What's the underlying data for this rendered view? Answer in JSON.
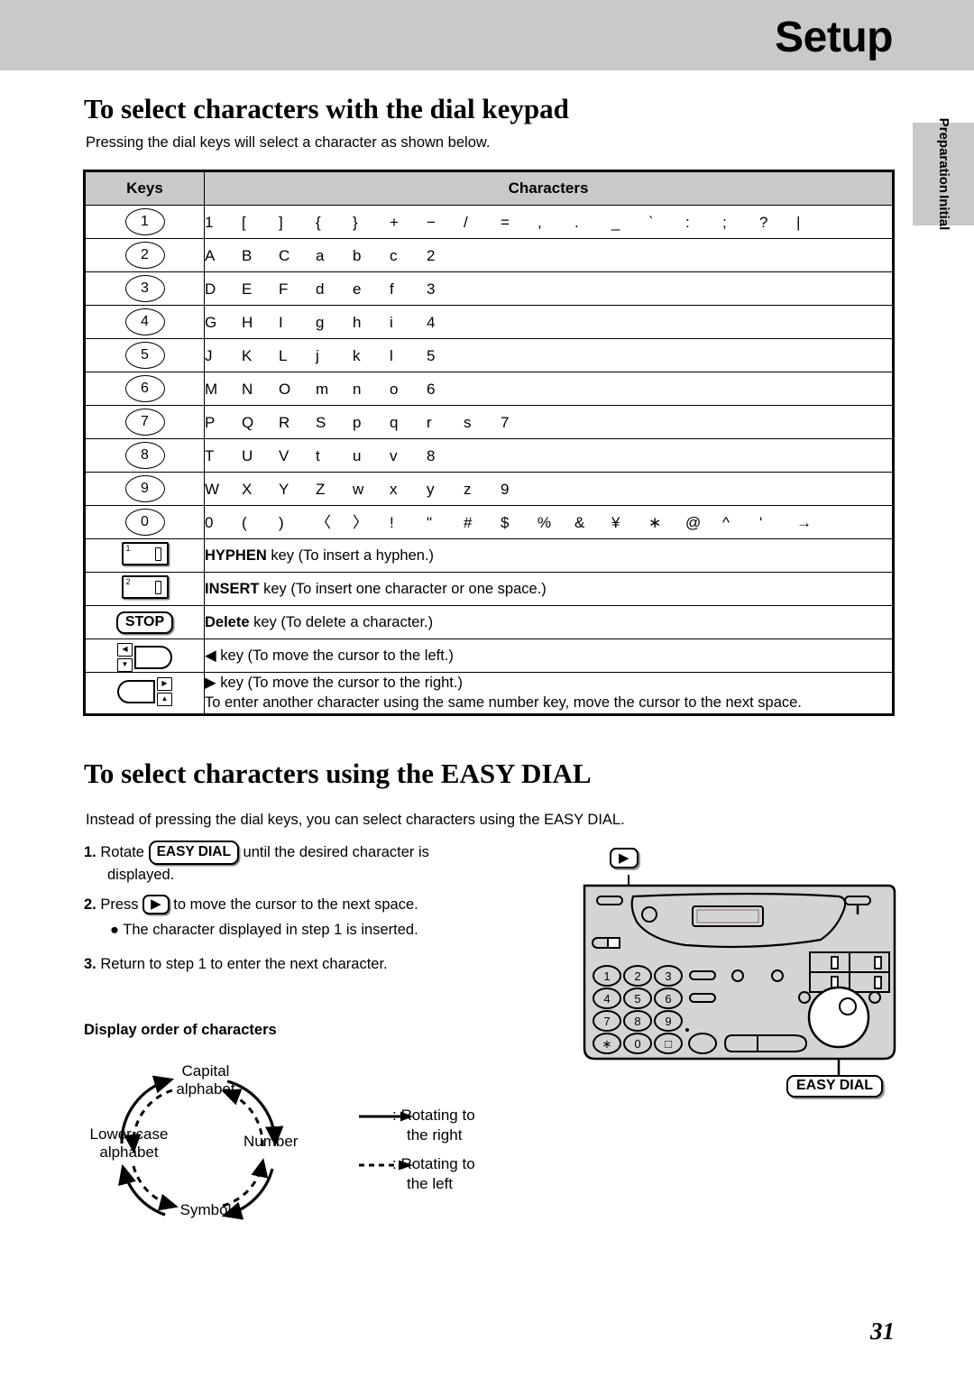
{
  "header": {
    "title": "Setup"
  },
  "side_tab": {
    "line1": "Initial",
    "line2": "Preparation"
  },
  "section1": {
    "heading": "To select characters with the dial keypad",
    "intro": "Pressing the dial keys will select a character as shown below.",
    "table": {
      "columns": [
        "Keys",
        "Characters"
      ],
      "rows": [
        {
          "key_type": "digit",
          "key": "1",
          "chars": [
            "1",
            "[",
            "]",
            "{",
            "}",
            "+",
            "−",
            "/",
            "=",
            ",",
            ".",
            "_",
            "`",
            ":",
            ";",
            "?",
            "|"
          ]
        },
        {
          "key_type": "digit",
          "key": "2",
          "chars": [
            "A",
            "B",
            "C",
            "a",
            "b",
            "c",
            "2"
          ]
        },
        {
          "key_type": "digit",
          "key": "3",
          "chars": [
            "D",
            "E",
            "F",
            "d",
            "e",
            "f",
            "3"
          ]
        },
        {
          "key_type": "digit",
          "key": "4",
          "chars": [
            "G",
            "H",
            "I",
            "g",
            "h",
            "i",
            "4"
          ]
        },
        {
          "key_type": "digit",
          "key": "5",
          "chars": [
            "J",
            "K",
            "L",
            "j",
            "k",
            "l",
            "5"
          ]
        },
        {
          "key_type": "digit",
          "key": "6",
          "chars": [
            "M",
            "N",
            "O",
            "m",
            "n",
            "o",
            "6"
          ]
        },
        {
          "key_type": "digit",
          "key": "7",
          "chars": [
            "P",
            "Q",
            "R",
            "S",
            "p",
            "q",
            "r",
            "s",
            "7"
          ]
        },
        {
          "key_type": "digit",
          "key": "8",
          "chars": [
            "T",
            "U",
            "V",
            "t",
            "u",
            "v",
            "8"
          ]
        },
        {
          "key_type": "digit",
          "key": "9",
          "chars": [
            "W",
            "X",
            "Y",
            "Z",
            "w",
            "x",
            "y",
            "z",
            "9"
          ]
        },
        {
          "key_type": "digit",
          "key": "0",
          "chars": [
            "0",
            "(",
            ")",
            "〈",
            "〉",
            "!",
            "\"",
            "#",
            "$",
            "%",
            "&",
            "¥",
            "∗",
            "@",
            "^",
            "'",
            "→"
          ]
        }
      ],
      "special_rows": [
        {
          "key_type": "flat-key",
          "sup": "1",
          "label_bold": "HYPHEN",
          "label_rest": " key (To insert a hyphen.)"
        },
        {
          "key_type": "flat-key",
          "sup": "2",
          "label_bold": "INSERT",
          "label_rest": " key (To insert one character or one space.)"
        },
        {
          "key_type": "stop-key",
          "key_label": "STOP",
          "label_bold": "Delete",
          "label_rest": " key (To delete a character.)"
        },
        {
          "key_type": "nav-left",
          "badge1": "◀",
          "badge2": "▼",
          "label_bold": "",
          "label_rest": "◀ key (To move the cursor to the left.)"
        },
        {
          "key_type": "nav-right",
          "badge1": "▶",
          "badge2": "▲",
          "label_bold": "",
          "label_rest": "▶ key (To move the cursor to the right.)",
          "label_line2": "To enter another character using the same number key, move the cursor to the next space."
        }
      ]
    }
  },
  "section2": {
    "heading": "To select characters using the EASY DIAL",
    "intro": "Instead of pressing the dial keys, you can select characters using the EASY DIAL.",
    "steps": [
      {
        "num": "1.",
        "pre": "Rotate ",
        "pill": "EASY DIAL",
        "post": " until the desired character is",
        "line2": "displayed."
      },
      {
        "num": "2.",
        "pre": "Press ",
        "pill_icon": "▶",
        "post": " to move the cursor to the next space."
      },
      {
        "bullet": "● The character displayed in step 1 is inserted."
      },
      {
        "num": "3.",
        "pre": "Return to step 1 to enter the next character.",
        "post": ""
      }
    ],
    "display_order": {
      "title": "Display order of characters",
      "nodes": {
        "capital": "Capital\nalphabet",
        "capital_l1": "Capital",
        "capital_l2": "alphabet",
        "number": "Number",
        "symbol": "Symbol",
        "lower_l1": "Lower case",
        "lower_l2": "alphabet"
      },
      "legend": {
        "solid_l1": ": Rotating to",
        "solid_l2": "the right",
        "dashed_l1": ": Rotating to",
        "dashed_l2": "the left"
      }
    },
    "illustration": {
      "arrow_callout": "▶",
      "easy_dial_callout": "EASY DIAL",
      "keypad": [
        "1",
        "2",
        "3",
        "4",
        "5",
        "6",
        "7",
        "8",
        "9",
        "∗",
        "0",
        "□"
      ]
    }
  },
  "footer": {
    "page_number": "31"
  },
  "colors": {
    "header_gray": "#c9c9c9",
    "table_header_gray": "#c9c9c9",
    "panel_gray": "#d4d4d4"
  }
}
